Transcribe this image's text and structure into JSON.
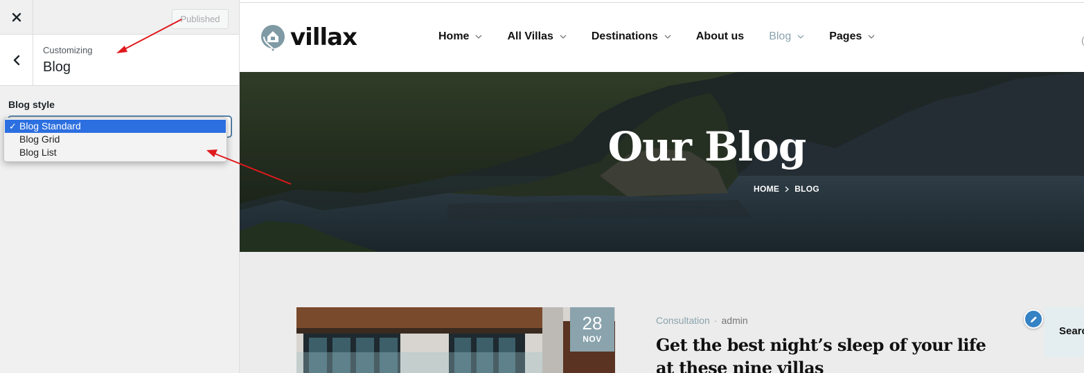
{
  "customizer": {
    "publish_label": "Published",
    "customizing_label": "Customizing",
    "section_title": "Blog",
    "field_label": "Blog style",
    "select_options": [
      "Blog Standard",
      "Blog Grid",
      "Blog List"
    ],
    "selected_option": "Blog Standard",
    "check_mark": "✓"
  },
  "site": {
    "logo_text": "villax",
    "nav": [
      "Home",
      "All Villas",
      "Destinations",
      "About us",
      "Blog",
      "Pages"
    ],
    "active_nav": "Blog",
    "hero_title": "Our Blog",
    "breadcrumb": [
      "HOME",
      "BLOG"
    ],
    "post": {
      "date_day": "28",
      "date_month": "NOV",
      "category": "Consultation",
      "meta_separator": "·",
      "author": "admin",
      "title": "Get the best night’s sleep of your life at these nine villas"
    },
    "search_label": "Search"
  },
  "colors": {
    "accent": "#8aa3ad",
    "wp_blue": "#2271b1",
    "annotation_arrow": "#e0191c"
  }
}
